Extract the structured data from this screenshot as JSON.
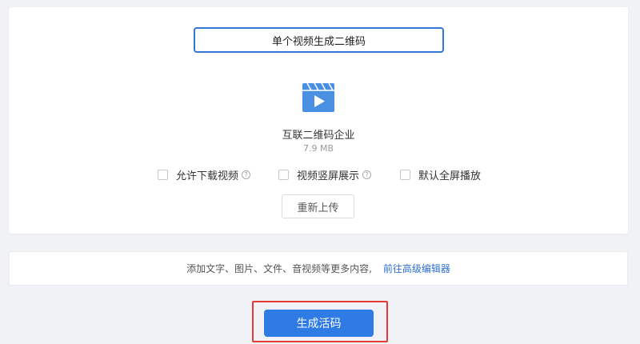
{
  "upload": {
    "title_value": "单个视频生成二维码",
    "file_icon": "video-file-icon",
    "file_name": "互联二维码企业",
    "file_size": "7.9 MB",
    "options": [
      {
        "label": "允许下载视频",
        "has_help": true,
        "checked": false
      },
      {
        "label": "视频竖屏展示",
        "has_help": true,
        "checked": false
      },
      {
        "label": "默认全屏播放",
        "has_help": false,
        "checked": false
      }
    ],
    "help_glyph": "?",
    "reupload_label": "重新上传"
  },
  "info": {
    "text": "添加文字、图片、文件、音视频等更多内容,",
    "link_label": "前往高级编辑器"
  },
  "actions": {
    "generate_label": "生成活码"
  },
  "colors": {
    "accent": "#2f7be6",
    "input_border": "#3377d6",
    "link": "#2f6fd0",
    "highlight": "#e53935",
    "icon": "#4a90e2"
  }
}
